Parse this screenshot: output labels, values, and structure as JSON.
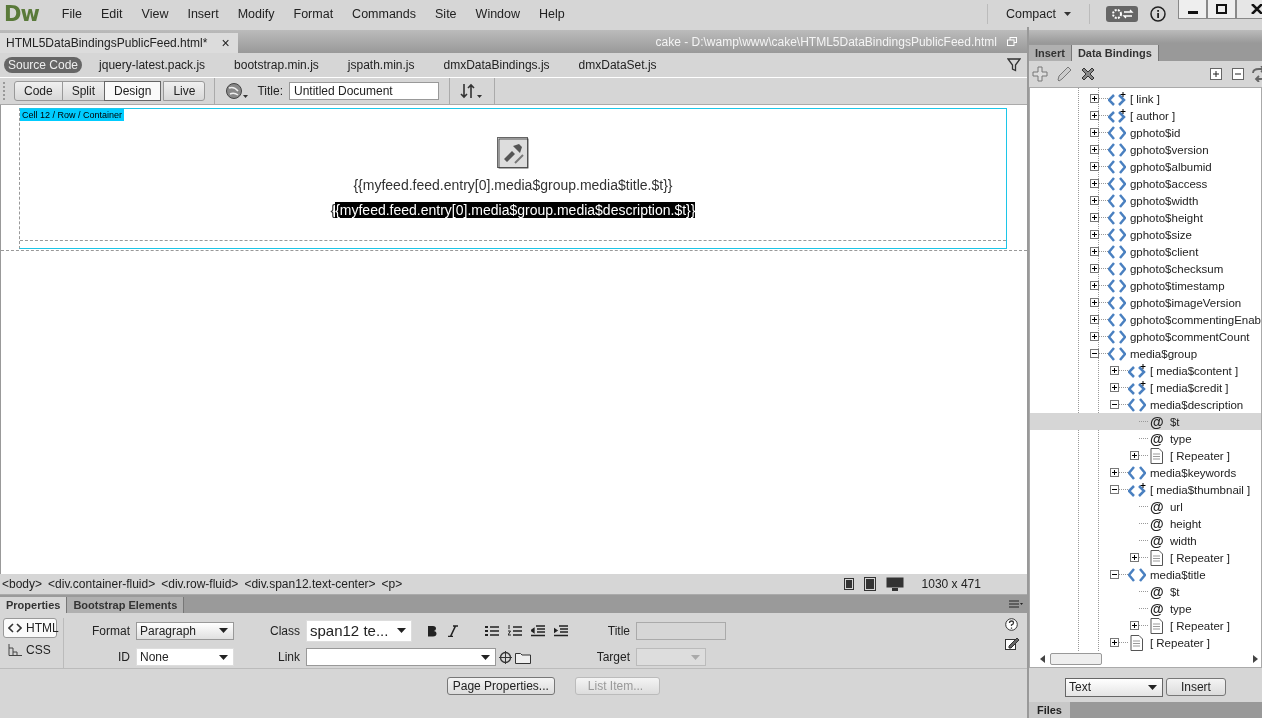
{
  "app": {
    "logo": "Dw",
    "menu": [
      "File",
      "Edit",
      "View",
      "Insert",
      "Modify",
      "Format",
      "Commands",
      "Site",
      "Window",
      "Help"
    ],
    "workspace": "Compact"
  },
  "document": {
    "tab": "HTML5DataBindingsPublicFeed.html*",
    "close": "×",
    "path": "cake - D:\\wamp\\www\\cake\\HTML5DataBindingsPublicFeed.html",
    "related_files": [
      {
        "label": "Source Code",
        "selected": true
      },
      {
        "label": "jquery-latest.pack.js",
        "selected": false
      },
      {
        "label": "bootstrap.min.js",
        "selected": false
      },
      {
        "label": "jspath.min.js",
        "selected": false
      },
      {
        "label": "dmxDataBindings.js",
        "selected": false
      },
      {
        "label": "dmxDataSet.js",
        "selected": false
      }
    ],
    "view_buttons": [
      {
        "label": "Code",
        "selected": false
      },
      {
        "label": "Split",
        "selected": false
      },
      {
        "label": "Design",
        "selected": true
      },
      {
        "label": "Live",
        "selected": false
      }
    ],
    "title_label": "Title:",
    "title_value": "Untitled Document"
  },
  "canvas": {
    "element_tag": "Cell 12 / Row / Container",
    "lines": [
      {
        "parts": [
          {
            "text": "{{myfeed.feed.entry[0].media$group.media$title.$t}}",
            "selected": false
          }
        ]
      },
      {
        "parts": [
          {
            "text": "{",
            "selected": false
          },
          {
            "text": "{myfeed.feed.entry[0].media$group.media$description.$t}}",
            "selected": true
          }
        ]
      }
    ]
  },
  "status_bar": {
    "tags": [
      "<body>",
      "<div.container-fluid>",
      "<div.row-fluid>",
      "<div.span12.text-center>",
      "<p>"
    ],
    "size": "1030 x 471"
  },
  "properties": {
    "tabs": [
      {
        "label": "Properties",
        "selected": true
      },
      {
        "label": "Bootstrap Elements",
        "selected": false
      }
    ],
    "modes": [
      {
        "label": "HTML",
        "selected": true
      },
      {
        "label": "CSS",
        "selected": false
      }
    ],
    "format_label": "Format",
    "format": "Paragraph",
    "id_label": "ID",
    "id": "None",
    "class_label": "Class",
    "class": "span12 te...",
    "link_label": "Link",
    "title_label": "Title",
    "target_label": "Target",
    "buttons": [
      {
        "label": "Page Properties...",
        "disabled": false
      },
      {
        "label": "List Item...",
        "disabled": true
      }
    ]
  },
  "panel": {
    "tabs": [
      {
        "label": "Insert",
        "selected": false
      },
      {
        "label": "Data Bindings",
        "selected": true
      }
    ],
    "tree": [
      {
        "label": "[ link ]",
        "kind": "array",
        "expanded": false,
        "selected": false
      },
      {
        "label": "[ author ]",
        "kind": "array",
        "expanded": false,
        "selected": false
      },
      {
        "label": "gphoto$id",
        "kind": "object",
        "expanded": false,
        "selected": false
      },
      {
        "label": "gphoto$version",
        "kind": "object",
        "expanded": false,
        "selected": false
      },
      {
        "label": "gphoto$albumid",
        "kind": "object",
        "expanded": false,
        "selected": false
      },
      {
        "label": "gphoto$access",
        "kind": "object",
        "expanded": false,
        "selected": false
      },
      {
        "label": "gphoto$width",
        "kind": "object",
        "expanded": false,
        "selected": false
      },
      {
        "label": "gphoto$height",
        "kind": "object",
        "expanded": false,
        "selected": false
      },
      {
        "label": "gphoto$size",
        "kind": "object",
        "expanded": false,
        "selected": false
      },
      {
        "label": "gphoto$client",
        "kind": "object",
        "expanded": false,
        "selected": false
      },
      {
        "label": "gphoto$checksum",
        "kind": "object",
        "expanded": false,
        "selected": false
      },
      {
        "label": "gphoto$timestamp",
        "kind": "object",
        "expanded": false,
        "selected": false
      },
      {
        "label": "gphoto$imageVersion",
        "kind": "object",
        "expanded": false,
        "selected": false
      },
      {
        "label": "gphoto$commentingEnab",
        "kind": "object",
        "expanded": false,
        "selected": false
      },
      {
        "label": "gphoto$commentCount",
        "kind": "object",
        "expanded": false,
        "selected": false
      },
      {
        "label": "media$group",
        "kind": "object",
        "expanded": true,
        "selected": false,
        "children": [
          {
            "label": "[ media$content ]",
            "kind": "array",
            "expanded": false,
            "selected": false
          },
          {
            "label": "[ media$credit ]",
            "kind": "array",
            "expanded": false,
            "selected": false
          },
          {
            "label": "media$description",
            "kind": "object",
            "expanded": true,
            "selected": false,
            "children": [
              {
                "label": "$t",
                "kind": "attribute",
                "marker": "@",
                "selected": true
              },
              {
                "label": "type",
                "kind": "attribute",
                "marker": "@",
                "selected": false
              },
              {
                "label": "[ Repeater ]",
                "kind": "repeater",
                "expanded": false,
                "selected": false
              }
            ]
          },
          {
            "label": "media$keywords",
            "kind": "object",
            "expanded": false,
            "selected": false
          },
          {
            "label": "[ media$thumbnail ]",
            "kind": "array",
            "expanded": true,
            "selected": false,
            "children": [
              {
                "label": "url",
                "kind": "attribute",
                "marker": "@",
                "selected": false
              },
              {
                "label": "height",
                "kind": "attribute",
                "marker": "@",
                "selected": false
              },
              {
                "label": "width",
                "kind": "attribute",
                "marker": "@",
                "selected": false
              },
              {
                "label": "[ Repeater ]",
                "kind": "repeater",
                "expanded": false,
                "selected": false
              }
            ]
          },
          {
            "label": "media$title",
            "kind": "object",
            "expanded": true,
            "selected": false,
            "children": [
              {
                "label": "$t",
                "kind": "attribute",
                "marker": "@",
                "selected": false
              },
              {
                "label": "type",
                "kind": "attribute",
                "marker": "@",
                "selected": false
              },
              {
                "label": "[ Repeater ]",
                "kind": "repeater",
                "expanded": false,
                "selected": false
              }
            ]
          },
          {
            "label": "[ Repeater ]",
            "kind": "repeater",
            "expanded": false,
            "selected": false
          }
        ]
      }
    ],
    "insert_as": "Text",
    "insert_button": "Insert",
    "files_tab": "Files"
  }
}
